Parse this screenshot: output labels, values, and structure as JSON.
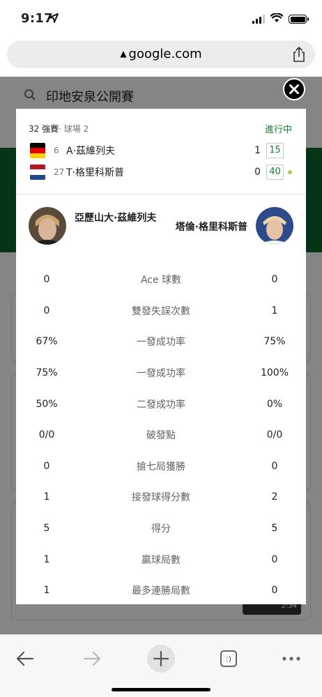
{
  "status_bar": {
    "time": "9:17"
  },
  "browser": {
    "url": "google.com"
  },
  "background_page": {
    "search_query": "印地安泉公開賽",
    "video_duration": "2:34"
  },
  "match": {
    "round": "32 強賽",
    "court": "· 球場 2",
    "status": "進行中",
    "players": [
      {
        "seed": "6",
        "name": "A·茲維列夫",
        "sets": "1",
        "game": "15",
        "flag": "germany",
        "serving": false
      },
      {
        "seed": "27",
        "name": "T·格里科斯普",
        "sets": "0",
        "game": "40",
        "flag": "netherlands",
        "serving": true
      }
    ]
  },
  "comparison": {
    "player1_full": "亞歷山大·茲維列夫",
    "player2_full": "塔倫·格里科斯普",
    "stats": [
      {
        "label": "Ace 球數",
        "p1": "0",
        "p2": "0"
      },
      {
        "label": "雙發失誤次數",
        "p1": "0",
        "p2": "1"
      },
      {
        "label": "一發成功率",
        "p1": "67%",
        "p2": "75%"
      },
      {
        "label": "一發成功率",
        "p1": "75%",
        "p2": "100%"
      },
      {
        "label": "二發成功率",
        "p1": "50%",
        "p2": "0%"
      },
      {
        "label": "破發點",
        "p1": "0/0",
        "p2": "0/0"
      },
      {
        "label": "搶七局獲勝",
        "p1": "0",
        "p2": "0"
      },
      {
        "label": "接發球得分數",
        "p1": "1",
        "p2": "2"
      },
      {
        "label": "得分",
        "p1": "5",
        "p2": "5"
      },
      {
        "label": "贏球局數",
        "p1": "1",
        "p2": "0"
      },
      {
        "label": "最多連勝局數",
        "p1": "1",
        "p2": "0"
      }
    ]
  },
  "icons": {
    "close": "close-icon",
    "back": "back-arrow-icon",
    "forward": "forward-arrow-icon",
    "new_tab": "plus-icon",
    "tabs": "tabs-icon",
    "more": "more-icon",
    "share": "share-icon"
  },
  "colors": {
    "live_green": "#188038",
    "serve_dot": "#a8d15a",
    "bg_green": "#0d652d"
  }
}
